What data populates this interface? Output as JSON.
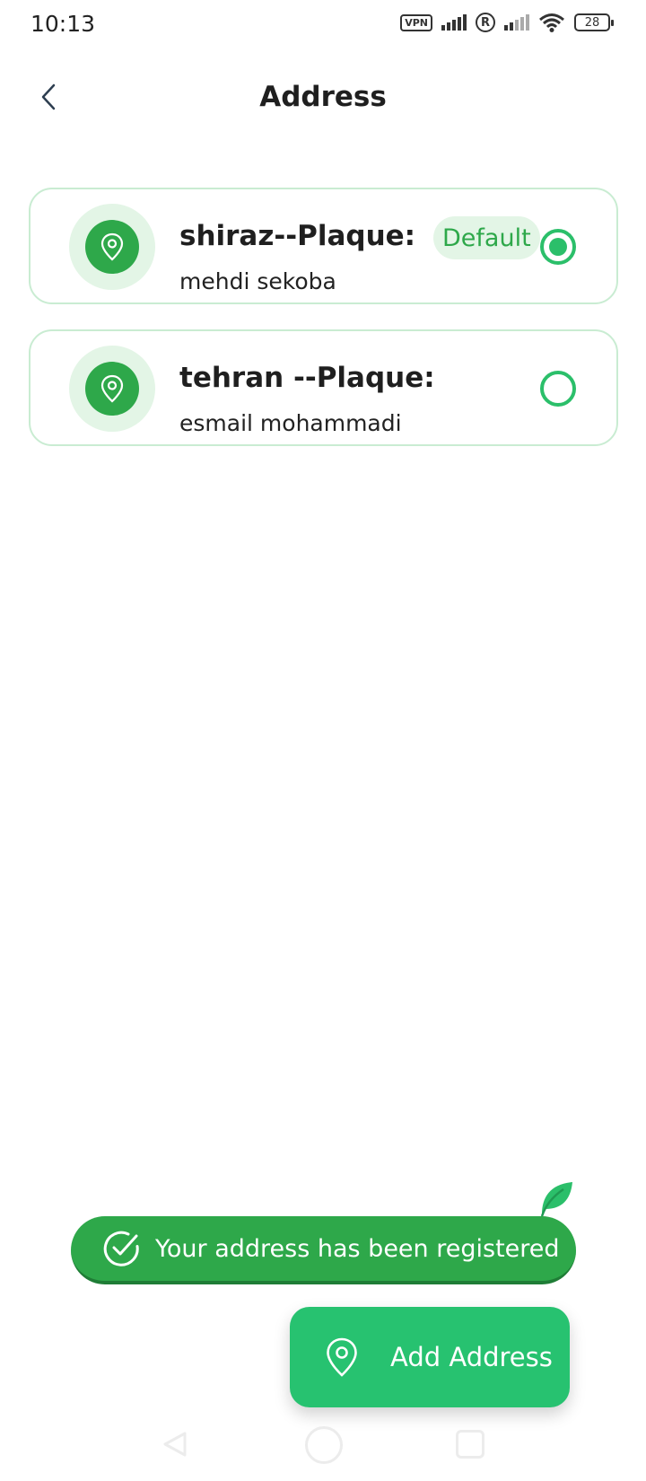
{
  "status_bar": {
    "time": "10:13",
    "vpn": "VPN",
    "r": "R",
    "battery": "28"
  },
  "header": {
    "back_icon": "chevron-left-icon",
    "title": "Address"
  },
  "addresses": [
    {
      "title": "shiraz--Plaque:",
      "subtitle": "mehdi sekoba",
      "badge": "Default",
      "selected": true
    },
    {
      "title": "tehran --Plaque:",
      "subtitle": "esmail mohammadi",
      "selected": false
    }
  ],
  "toast": {
    "message": "Your address has been registered",
    "icon": "check-circle-icon"
  },
  "add_button": {
    "label": "Add Address",
    "icon": "location-pin-icon"
  },
  "colors": {
    "primary_green": "#2ea84a",
    "button_green": "#27c270",
    "radio_green": "#2bbf6a",
    "light_green": "#e3f5e6",
    "card_border": "#c9ecd2"
  }
}
